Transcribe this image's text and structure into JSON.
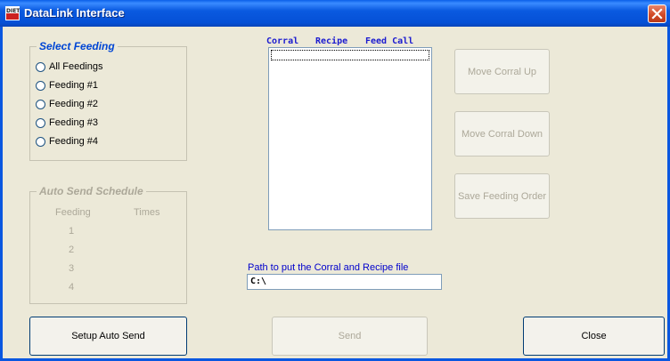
{
  "window": {
    "title": "DataLink Interface"
  },
  "select_feeding": {
    "legend": "Select Feeding",
    "options": [
      "All Feedings",
      "Feeding #1",
      "Feeding #2",
      "Feeding #3",
      "Feeding #4"
    ]
  },
  "auto_send": {
    "legend": "Auto Send Schedule",
    "col_feeding": "Feeding",
    "col_times": "Times",
    "rows": [
      "1",
      "2",
      "3",
      "4"
    ]
  },
  "list": {
    "headers": [
      "Corral",
      "Recipe",
      "Feed Call"
    ]
  },
  "buttons": {
    "move_up": "Move Corral Up",
    "move_down": "Move Corral Down",
    "save_order": "Save Feeding Order",
    "setup_auto_send": "Setup Auto Send",
    "send": "Send",
    "close": "Close"
  },
  "path": {
    "label": "Path to put the Corral and Recipe file",
    "value": "C:\\"
  },
  "colors": {
    "title_bar": "#0a57e0",
    "header_text": "#1b1bd0",
    "path_label": "#0000cc",
    "legend_blue": "#0046d5",
    "disabled_text": "#aca899"
  }
}
